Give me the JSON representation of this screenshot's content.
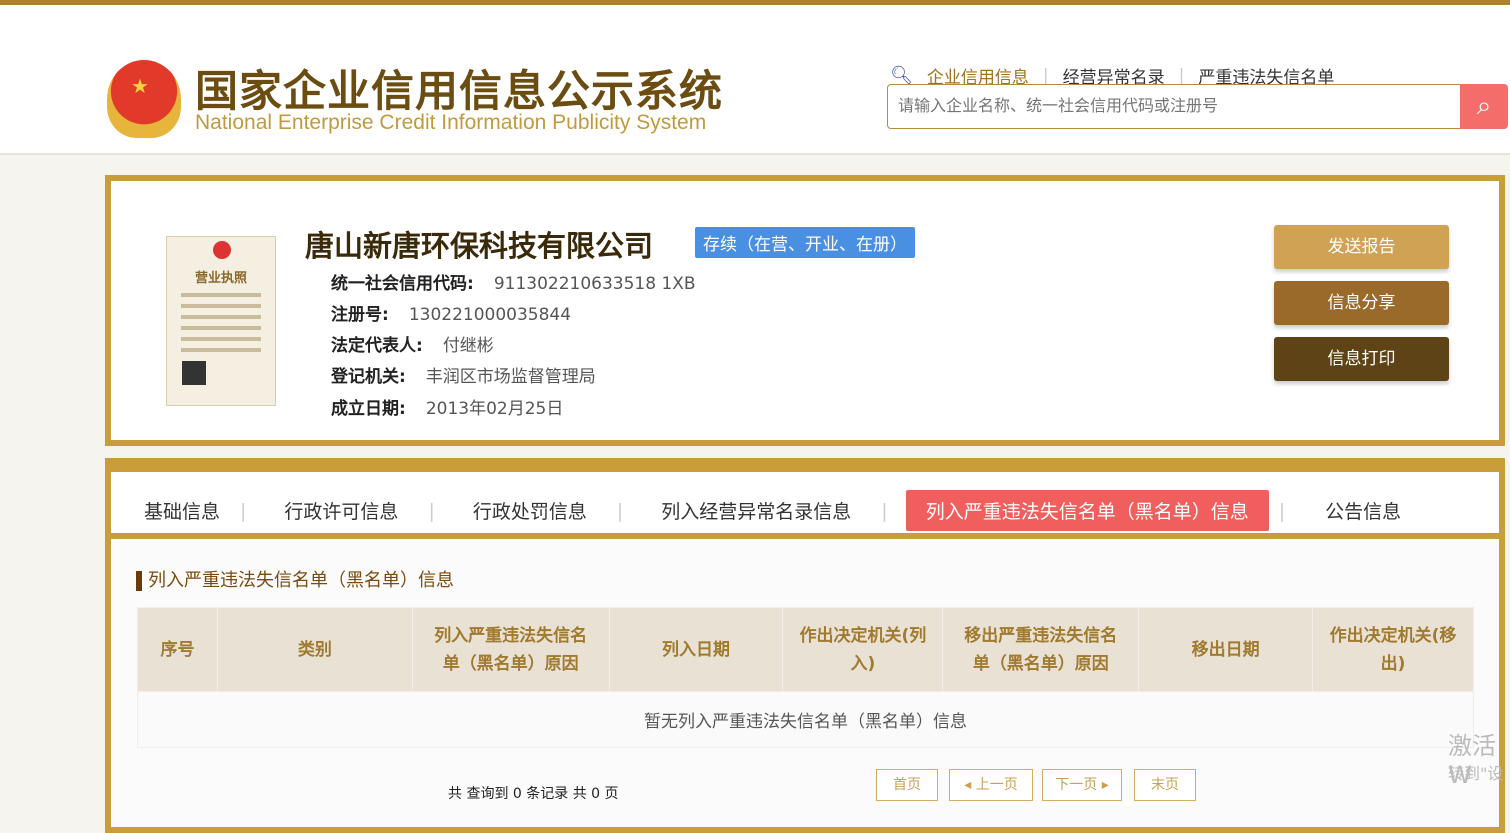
{
  "header": {
    "title_cn": "国家企业信用信息公示系统",
    "title_en": "National Enterprise Credit Information Publicity System",
    "links": [
      "企业信用信息",
      "经营异常名录",
      "严重违法失信名单"
    ],
    "search_placeholder": "请输入企业名称、统一社会信用代码或注册号"
  },
  "company": {
    "name": "唐山新唐环保科技有限公司",
    "status": "存续（在营、开业、在册）",
    "license_title": "营业执照",
    "fields": [
      {
        "label": "统一社会信用代码:",
        "value": "911302210633518 1XB"
      },
      {
        "label": "注册号:",
        "value": "130221000035844"
      },
      {
        "label": "法定代表人:",
        "value": "付继彬"
      },
      {
        "label": "登记机关:",
        "value": "丰润区市场监督管理局"
      },
      {
        "label": "成立日期:",
        "value": "2013年02月25日"
      }
    ],
    "actions": [
      "发送报告",
      "信息分享",
      "信息打印"
    ],
    "action_colors": [
      "#c9a050",
      "#9a6a2a",
      "#5e4317"
    ]
  },
  "tabs": [
    "基础信息",
    "行政许可信息",
    "行政处罚信息",
    "列入经营异常名录信息",
    "列入严重违法失信名单（黑名单）信息",
    "公告信息"
  ],
  "section": {
    "title": "列入严重违法失信名单（黑名单）信息",
    "columns": [
      "序号",
      "类别",
      "列入严重违法失信名单（黑名单）原因",
      "列入日期",
      "作出决定机关(列入)",
      "移出严重违法失信名单（黑名单）原因",
      "移出日期",
      "作出决定机关(移出)"
    ],
    "empty": "暂无列入严重违法失信名单（黑名单）信息",
    "total": "共 查询到 0 条记录 共 0 页",
    "pager": [
      "首页",
      "◂ 上一页",
      "下一页 ▸",
      "末页"
    ]
  },
  "watermark": [
    "激活 W",
    "转到\"设"
  ]
}
